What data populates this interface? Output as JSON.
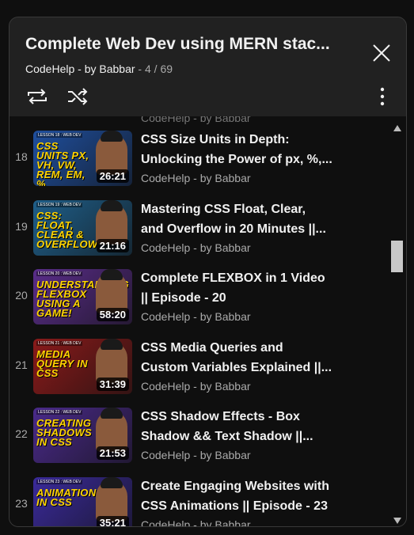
{
  "header": {
    "title": "Complete Web Dev using MERN stac...",
    "channel": "CodeHelp - by Babbar",
    "position": "4 / 69",
    "separator": " - "
  },
  "icons": {
    "close": "close-icon",
    "loop": "loop-icon",
    "shuffle": "shuffle-icon",
    "more": "more-vertical-icon"
  },
  "list": {
    "partial_channel_top": "CodeHelp - by Babbar",
    "partial_channel_bottom": "CodeHelp - by Babbar",
    "items": [
      {
        "index": "18",
        "title_line1": "CSS Size Units in Depth:",
        "title_line2": "Unlocking the Power of px, %,...",
        "channel": "CodeHelp - by Babbar",
        "duration": "26:21",
        "thumb_text": "CSS UNITS PX, VH, VW, REM, EM, %",
        "thumb_tag": "LESSON 18 : WEB DEV",
        "thumb_bg": "#1f4f9e"
      },
      {
        "index": "19",
        "title_line1": "Mastering CSS Float, Clear,",
        "title_line2": "and Overflow in 20 Minutes ||...",
        "channel": "CodeHelp - by Babbar",
        "duration": "21:16",
        "thumb_text": "CSS: FLOAT, CLEAR & OVERFLOW",
        "thumb_tag": "LESSON 19 : WEB DEV",
        "thumb_bg": "#1f5f8a"
      },
      {
        "index": "20",
        "title_line1": "Complete FLEXBOX in 1 Video",
        "title_line2": "|| Episode - 20",
        "channel": "CodeHelp - by Babbar",
        "duration": "58:20",
        "thumb_text": "UNDERSTANDING FLEXBOX USING A GAME!",
        "thumb_tag": "LESSON 20 : WEB DEV",
        "thumb_bg": "#5a2d8a"
      },
      {
        "index": "21",
        "title_line1": "CSS Media Queries and",
        "title_line2": "Custom Variables Explained ||...",
        "channel": "CodeHelp - by Babbar",
        "duration": "31:39",
        "thumb_text": "MEDIA QUERY IN CSS",
        "thumb_tag": "LESSON 21 : WEB DEV",
        "thumb_bg": "#8a1a1a"
      },
      {
        "index": "22",
        "title_line1": "CSS Shadow Effects - Box",
        "title_line2": "Shadow && Text Shadow ||...",
        "channel": "CodeHelp - by Babbar",
        "duration": "21:53",
        "thumb_text": "CREATING SHADOWS IN CSS",
        "thumb_tag": "LESSON 22 : WEB DEV",
        "thumb_bg": "#4a2a8a"
      },
      {
        "index": "23",
        "title_line1": "Create Engaging Websites with",
        "title_line2": "CSS Animations || Episode - 23",
        "channel": "CodeHelp - by Babbar",
        "duration": "35:21",
        "thumb_text": "ANIMATIONS IN CSS",
        "thumb_tag": "LESSON 23 : WEB DEV",
        "thumb_bg": "#3a2a9a"
      }
    ]
  }
}
